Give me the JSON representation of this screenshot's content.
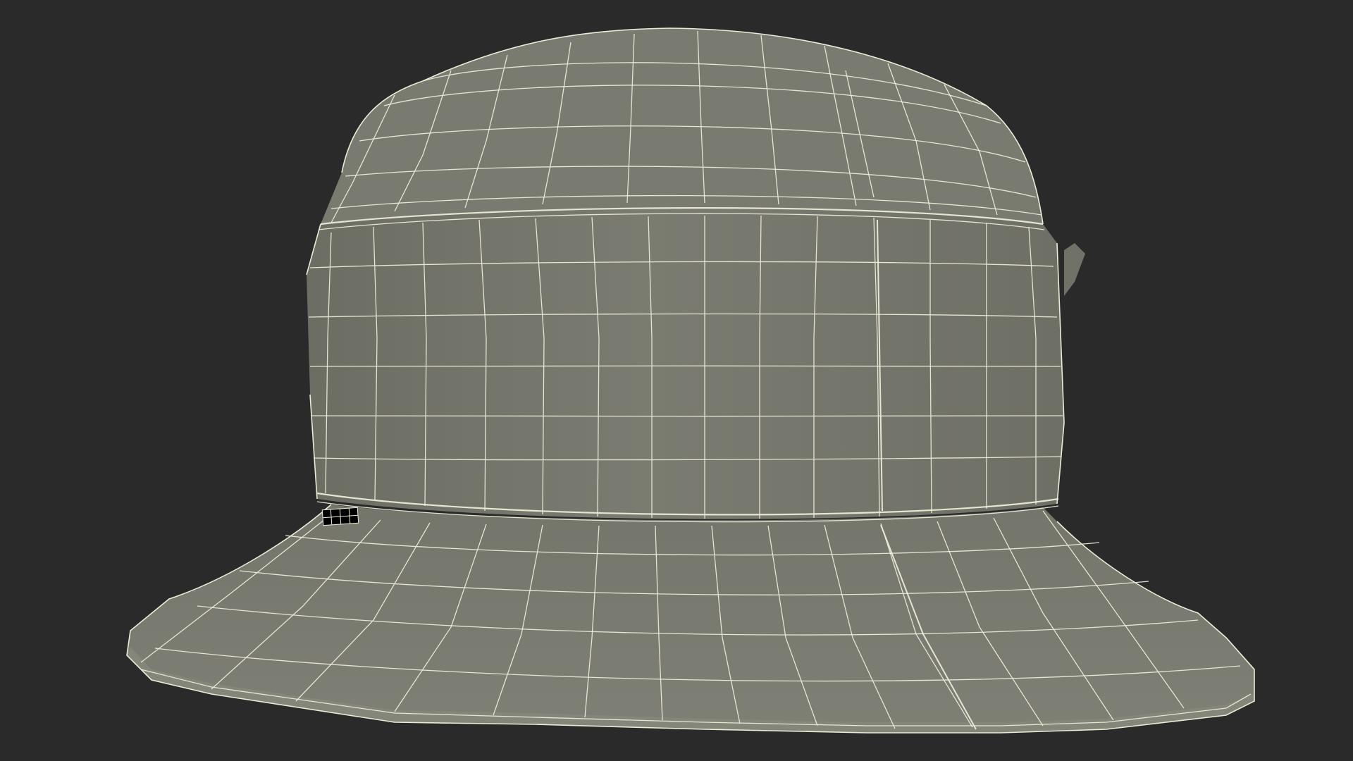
{
  "scene": {
    "subject": "bucket-hat",
    "render_mode": "wireframe-over-shaded",
    "colors": {
      "background": "#2a2a2a",
      "surface": "#7a7b70",
      "surface_dark": "#62635a",
      "surface_light": "#8a8b80",
      "wire": "#ecebd8"
    }
  }
}
